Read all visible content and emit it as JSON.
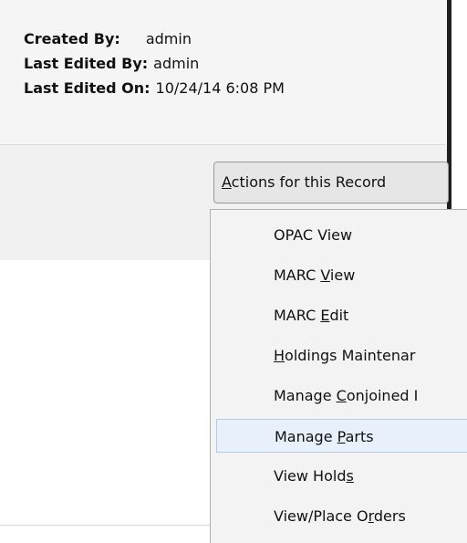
{
  "record_meta": {
    "created_by_label": "Created By:",
    "created_by": "admin",
    "last_edited_by_label": "Last Edited By:",
    "last_edited_by": "admin",
    "last_edited_on_label": "Last Edited On:",
    "last_edited_on": "10/24/14 6:08 PM"
  },
  "actions_button": {
    "accel": "A",
    "rest": "ctions for this Record"
  },
  "menu": {
    "items": [
      {
        "pre": "OPAC View",
        "accel": "",
        "post": ""
      },
      {
        "pre": "MARC ",
        "accel": "V",
        "post": "iew"
      },
      {
        "pre": "MARC ",
        "accel": "E",
        "post": "dit"
      },
      {
        "pre": "",
        "accel": "H",
        "post": "oldings Maintenar"
      },
      {
        "pre": "Manage ",
        "accel": "C",
        "post": "onjoined I"
      },
      {
        "pre": "Manage ",
        "accel": "P",
        "post": "arts"
      },
      {
        "pre": "View Hold",
        "accel": "s",
        "post": ""
      },
      {
        "pre": "View/Place O",
        "accel": "r",
        "post": "ders"
      }
    ]
  }
}
